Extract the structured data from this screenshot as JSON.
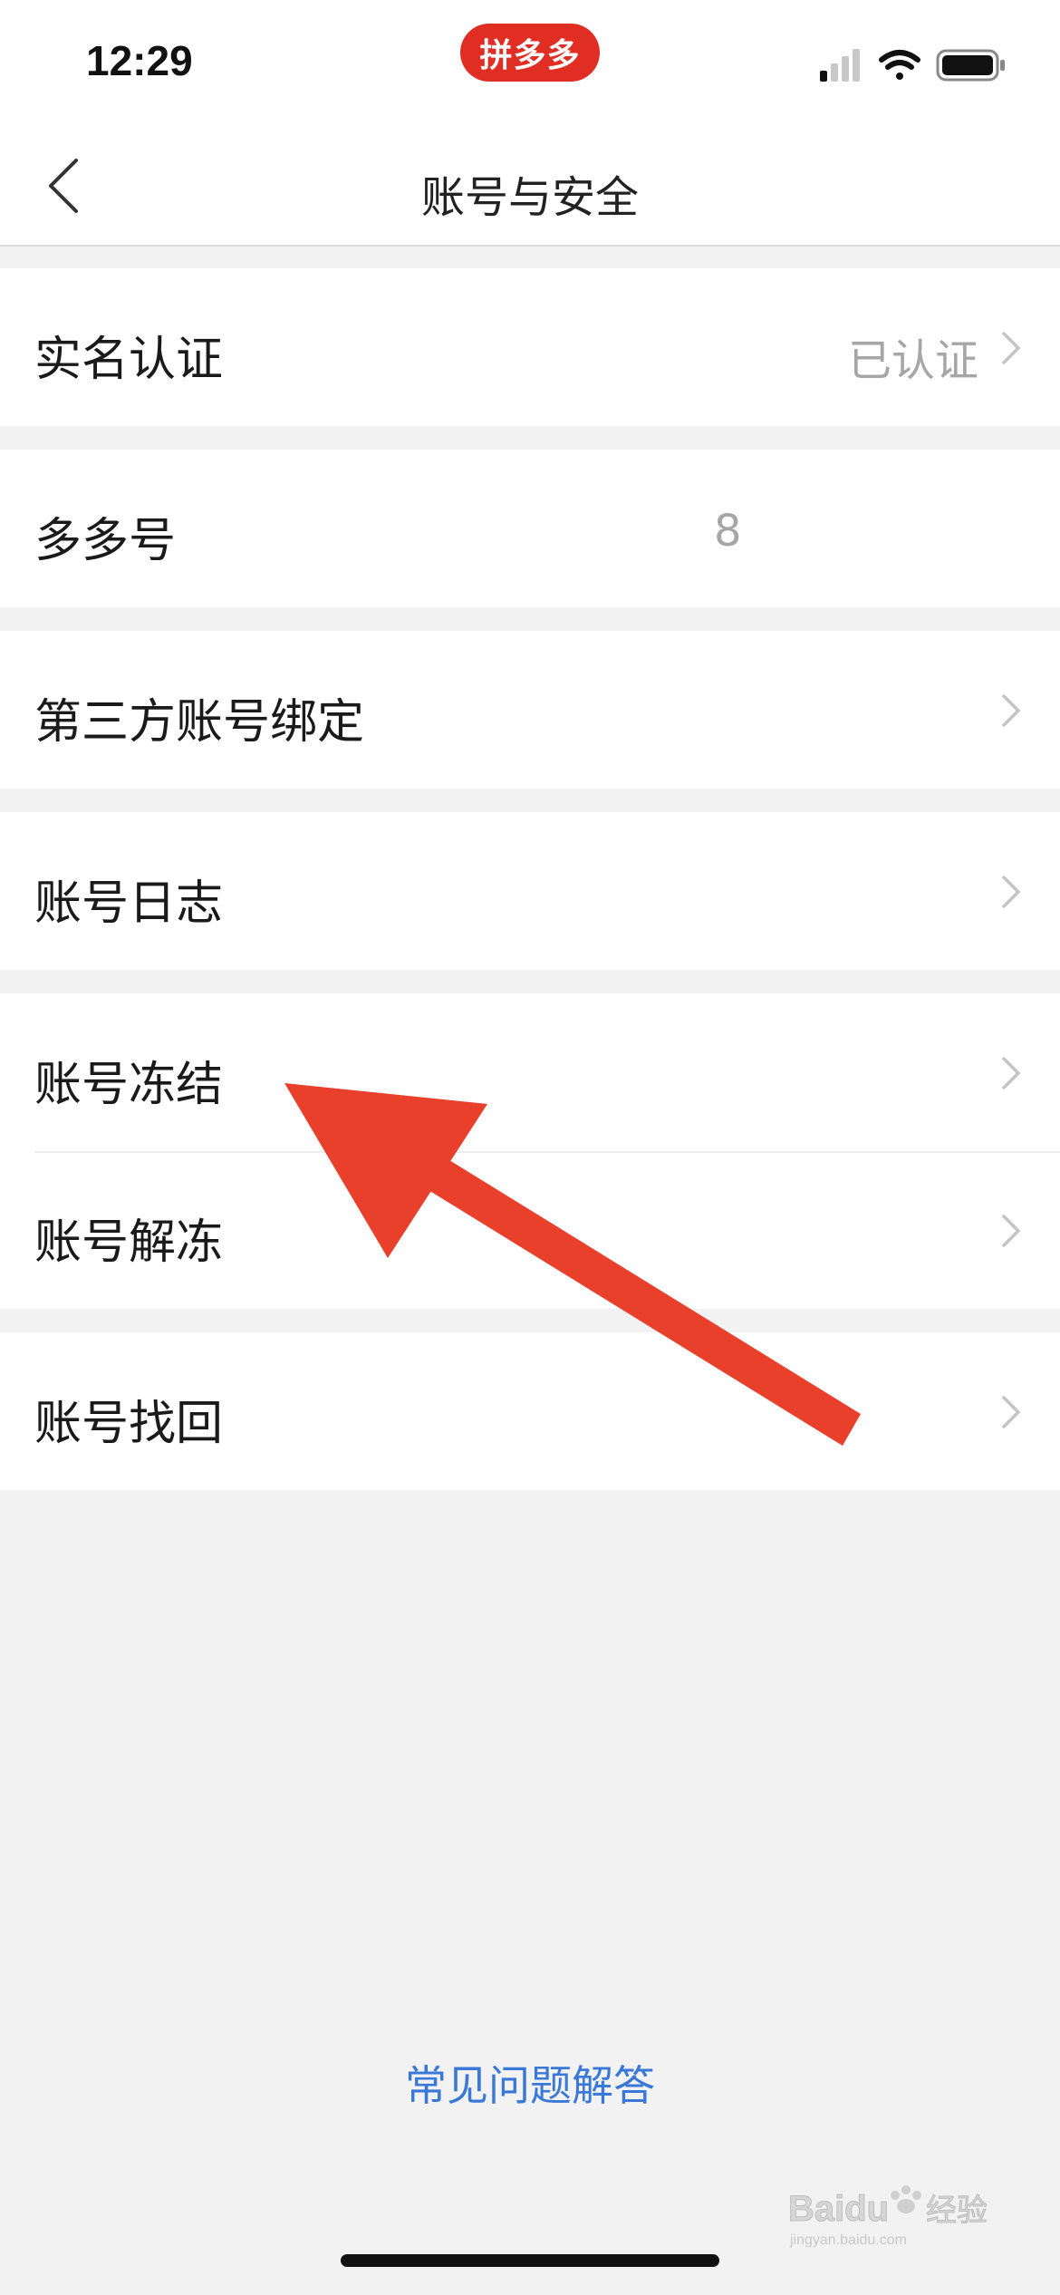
{
  "status_bar": {
    "time": "12:29",
    "app_badge": "拼多多",
    "icons": [
      "signal-icon",
      "wifi-icon",
      "battery-icon"
    ]
  },
  "nav": {
    "title": "账号与安全",
    "back_icon": "chevron-left-icon"
  },
  "rows": {
    "real_name": {
      "label": "实名认证",
      "value": "已认证"
    },
    "duoduo_id": {
      "label": "多多号",
      "value": "8"
    },
    "third_party": {
      "label": "第三方账号绑定"
    },
    "account_log": {
      "label": "账号日志"
    },
    "freeze": {
      "label": "账号冻结"
    },
    "unfreeze": {
      "label": "账号解冻"
    },
    "recover": {
      "label": "账号找回"
    }
  },
  "faq": {
    "label": "常见问题解答"
  },
  "watermark": {
    "brand": "Baidu",
    "subtext": "经验",
    "url": "jingyan.baidu.com"
  },
  "colors": {
    "accent_red": "#e02e24",
    "link_blue": "#3a78d8",
    "annotation_arrow": "#e8402a",
    "background": "#f2f2f2"
  }
}
